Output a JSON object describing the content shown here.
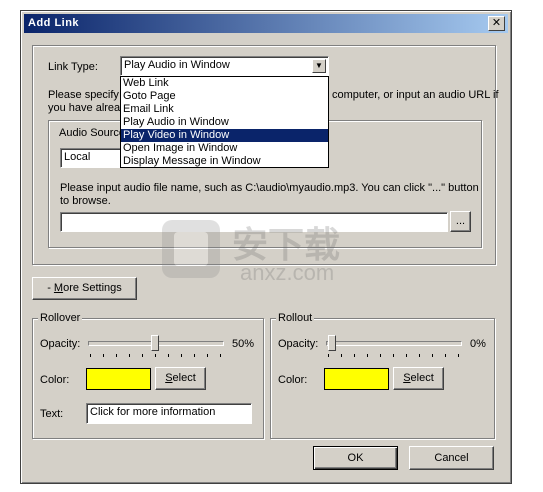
{
  "dialog": {
    "title": "Add Link",
    "close_glyph": "✕"
  },
  "link_type": {
    "label": "Link Type:",
    "selected": "Play Audio in Window",
    "options": [
      "Web Link",
      "Goto Page",
      "Email Link",
      "Play Audio in Window",
      "Play Video in Window",
      "Open Image in Window",
      "Display Message in Window"
    ],
    "highlighted_index": 4
  },
  "instructions": {
    "line1_left": "Please specify",
    "line1_right": "computer, or input an audio URL if",
    "line2_left": "you have alrea"
  },
  "audio_source": {
    "label": "Audio Source",
    "selected": "Local",
    "hint_line1": "Please input audio file name, such as C:\\audio\\myaudio.mp3. You can click \"...\" button",
    "hint_line2": "to browse.",
    "file_value": "",
    "browse_label": "..."
  },
  "more_settings": {
    "label_prefix": "- ",
    "label_u": "M",
    "label_rest": "ore Settings"
  },
  "rollover": {
    "title": "Rollover",
    "opacity_label": "Opacity:",
    "opacity_value": "50%",
    "opacity_fraction": 0.5,
    "color_label": "Color:",
    "color": "#ffff00",
    "select_u": "S",
    "select_rest": "elect",
    "text_label": "Text:",
    "text_value": "Click for more information"
  },
  "rollout": {
    "title": "Rollout",
    "opacity_label": "Opacity:",
    "opacity_value": "0%",
    "opacity_fraction": 0.0,
    "color_label": "Color:",
    "color": "#ffff00",
    "select_u": "S",
    "select_rest": "elect"
  },
  "buttons": {
    "ok": "OK",
    "cancel": "Cancel"
  },
  "watermark": {
    "line1": "安下载",
    "line2": "anxz.com"
  }
}
